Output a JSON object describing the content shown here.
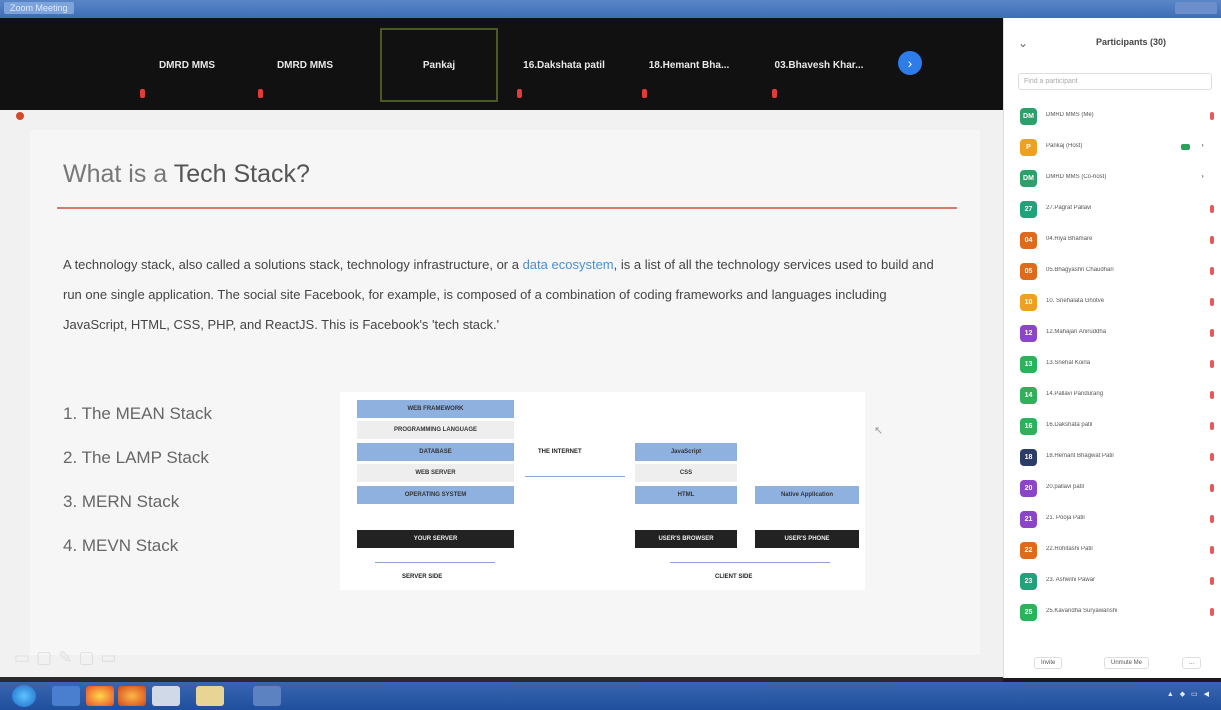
{
  "window": {
    "title": "Zoom Meeting"
  },
  "video_strip": {
    "tiles": [
      {
        "name": "DMRD MMS",
        "muted": true
      },
      {
        "name": "DMRD MMS",
        "muted": true
      },
      {
        "name": "Pankaj",
        "muted": false,
        "active": true
      },
      {
        "name": "16.Dakshata patil",
        "muted": true
      },
      {
        "name": "18.Hemant Bha...",
        "muted": true
      },
      {
        "name": "03.Bhavesh Khar...",
        "muted": true
      }
    ],
    "next_icon": "›"
  },
  "slide": {
    "title_prefix": "What is a ",
    "title_emphasis": "Tech Stack?",
    "paragraph_before_link": "A technology stack, also called a solutions stack, technology infrastructure, or a ",
    "link_text": "data ecosystem",
    "paragraph_after_link": ", is a list of all the technology services used to build and run one single application. The social site Facebook, for example, is composed of a combination of coding frameworks and languages including JavaScript, HTML, CSS, PHP, and ReactJS. This is Facebook's 'tech stack.'",
    "stacks": [
      "1. The MEAN Stack",
      "2. The LAMP Stack",
      "3. MERN Stack",
      "4. MEVN Stack"
    ],
    "diagram": {
      "server_blocks": [
        "WEB FRAMEWORK",
        "PROGRAMMING LANGUAGE",
        "DATABASE",
        "WEB SERVER",
        "OPERATING SYSTEM"
      ],
      "internet_label": "THE INTERNET",
      "client_blocks": [
        "JavaScript",
        "CSS",
        "HTML"
      ],
      "native_app": "Native Application",
      "your_server": "YOUR SERVER",
      "users_browser": "USER'S BROWSER",
      "users_phone": "USER'S PHONE",
      "server_side": "SERVER SIDE",
      "client_side": "CLIENT SIDE"
    }
  },
  "participants_panel": {
    "title": "Participants (30)",
    "search_placeholder": "Find a participant",
    "participants": [
      {
        "initial": "DM",
        "name": "DMRD MMS (Me)",
        "color": "#2f9e6a"
      },
      {
        "initial": "P",
        "name": "Pankaj (Host)",
        "color": "#f0a020",
        "video": true
      },
      {
        "initial": "DM",
        "name": "DMRD MMS (Co-host)",
        "color": "#2f9e6a"
      },
      {
        "initial": "27",
        "name": "27.Pagrat Pallavi",
        "color": "#1fa37a"
      },
      {
        "initial": "04",
        "name": "04.Riya Bhamare",
        "color": "#e06a1c"
      },
      {
        "initial": "05",
        "name": "05.Bhagyashri Chaudhari",
        "color": "#e06a1c"
      },
      {
        "initial": "10",
        "name": "10. Snehalata Ghotve",
        "color": "#f0a020"
      },
      {
        "initial": "12",
        "name": "12.Mahajan Aniruddha",
        "color": "#8a45c8"
      },
      {
        "initial": "13",
        "name": "13.Snehal Koirla",
        "color": "#2fb05a"
      },
      {
        "initial": "14",
        "name": "14.Pallavi Pandurang",
        "color": "#2fb05a"
      },
      {
        "initial": "16",
        "name": "16.Dakshata patil",
        "color": "#2fb05a"
      },
      {
        "initial": "18",
        "name": "18.Hemant Bhagwat Patil",
        "color": "#2d3c66"
      },
      {
        "initial": "20",
        "name": "20.pallavi patil",
        "color": "#8a45c8"
      },
      {
        "initial": "21",
        "name": "21. Pooja Patil",
        "color": "#8a45c8"
      },
      {
        "initial": "22",
        "name": "22.Rohitashi Patil",
        "color": "#e06a1c"
      },
      {
        "initial": "23",
        "name": "23. Ashwini Pawar",
        "color": "#1fa37a"
      },
      {
        "initial": "25",
        "name": "25.Kavandha Suryawanshi",
        "color": "#2fb05a"
      }
    ],
    "invite_label": "Invite",
    "mute_all_label": "Unmute Me",
    "more_label": "..."
  },
  "taskbar": {
    "tray_text": "▲ ◆ ▭ ◀"
  }
}
